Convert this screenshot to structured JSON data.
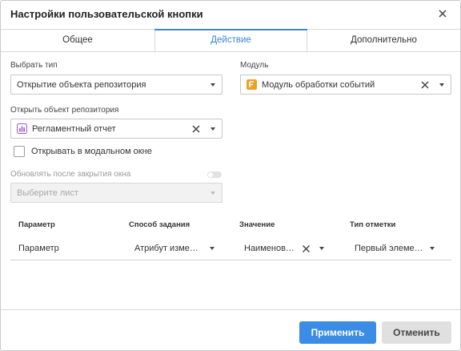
{
  "dialog": {
    "title": "Настройки пользовательской кнопки"
  },
  "tabs": [
    {
      "label": "Общее",
      "active": false
    },
    {
      "label": "Действие",
      "active": true
    },
    {
      "label": "Дополнительно",
      "active": false
    }
  ],
  "form": {
    "type_label": "Выбрать тип",
    "type_value": "Открытие объекта репозитория",
    "module_label": "Модуль",
    "module_value": "Модуль обработки событий",
    "repo_label": "Открыть объект репозитория",
    "repo_value": "Регламентный отчет",
    "modal_checkbox_label": "Открывать в модальном окне",
    "modal_checked": false,
    "refresh_label": "Обновлять после закрытия окна",
    "refresh_enabled": false,
    "sheet_placeholder": "Выберите лист"
  },
  "table": {
    "headers": [
      "Параметр",
      "Способ задания",
      "Значение",
      "Тип отметки"
    ],
    "rows": [
      [
        "Параметр",
        "Атрибут изме…",
        "Наименов…",
        "Первый элеме…"
      ]
    ]
  },
  "footer": {
    "apply_label": "Применить",
    "cancel_label": "Отменить"
  },
  "colors": {
    "accent": "#3b86d6",
    "apply_button": "#3b8ce4",
    "cancel_button": "#e0e0e0",
    "module_icon": "#f0a020",
    "report_icon": "#9a5ad1"
  },
  "icons": {
    "close": "close-icon",
    "module": "module-icon",
    "report": "report-icon",
    "clear": "clear-icon",
    "dropdown": "chevron-down-icon"
  }
}
